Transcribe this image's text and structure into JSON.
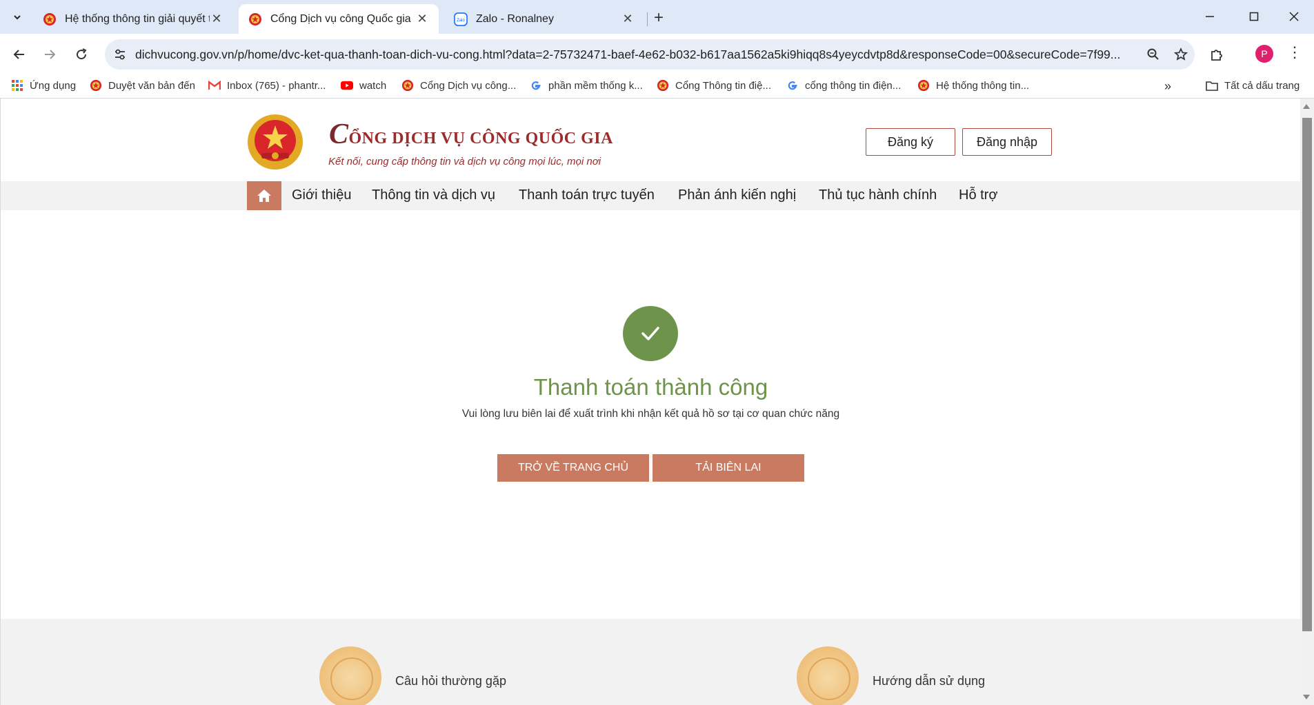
{
  "browser": {
    "tabs": [
      {
        "title": "Hệ thống thông tin giải quyết t",
        "active": false
      },
      {
        "title": "Cổng Dịch vụ công Quốc gia",
        "active": true
      },
      {
        "title": "Zalo - Ronalney",
        "active": false
      }
    ],
    "url": "dichvucong.gov.vn/p/home/dvc-ket-qua-thanh-toan-dich-vu-cong.html?data=2-75732471-baef-4e62-b032-b617aa1562a5ki9hiqq8s4yeycdvtp8d&responseCode=00&secureCode=7f99...",
    "profile_initial": "P",
    "bookmarks": [
      {
        "label": "Ứng dụng",
        "icon": "apps-grid-icon"
      },
      {
        "label": "Duyệt văn bản đến",
        "icon": "emblem-icon"
      },
      {
        "label": "Inbox (765) - phantr...",
        "icon": "gmail-icon"
      },
      {
        "label": "watch",
        "icon": "youtube-icon"
      },
      {
        "label": "Cổng Dịch vụ công...",
        "icon": "emblem-icon"
      },
      {
        "label": "phần mềm thống k...",
        "icon": "google-icon"
      },
      {
        "label": "Cổng Thông tin điệ...",
        "icon": "emblem-icon"
      },
      {
        "label": "cổng thông tin điện...",
        "icon": "google-icon"
      },
      {
        "label": "Hệ thống thông tin...",
        "icon": "emblem-icon"
      }
    ],
    "all_bookmarks_label": "Tất cả dấu trang"
  },
  "header": {
    "title_initial": "C",
    "title_rest": "ỔNG DỊCH VỤ CÔNG QUỐC GIA",
    "subtitle": "Kết nối, cung cấp thông tin và dịch vụ công mọi lúc, mọi nơi",
    "register_label": "Đăng ký",
    "login_label": "Đăng nhập"
  },
  "menu": {
    "items": [
      "Giới thiệu",
      "Thông tin và dịch vụ",
      "Thanh toán trực tuyến",
      "Phản ánh kiến nghị",
      "Thủ tục hành chính",
      "Hỗ trợ"
    ]
  },
  "result": {
    "title": "Thanh toán thành công",
    "message": "Vui lòng lưu biên lai để xuất trình khi nhận kết quả hồ sơ tại cơ quan chức năng",
    "home_button": "TRỞ VỀ TRANG CHỦ",
    "receipt_button": "TẢI BIÊN LAI"
  },
  "footer": {
    "links": [
      "Câu hỏi thường gặp",
      "Hướng dẫn sử dụng"
    ]
  },
  "colors": {
    "accent": "#c97a60",
    "success": "#6e934a",
    "brand_red": "#9c2b2b"
  }
}
